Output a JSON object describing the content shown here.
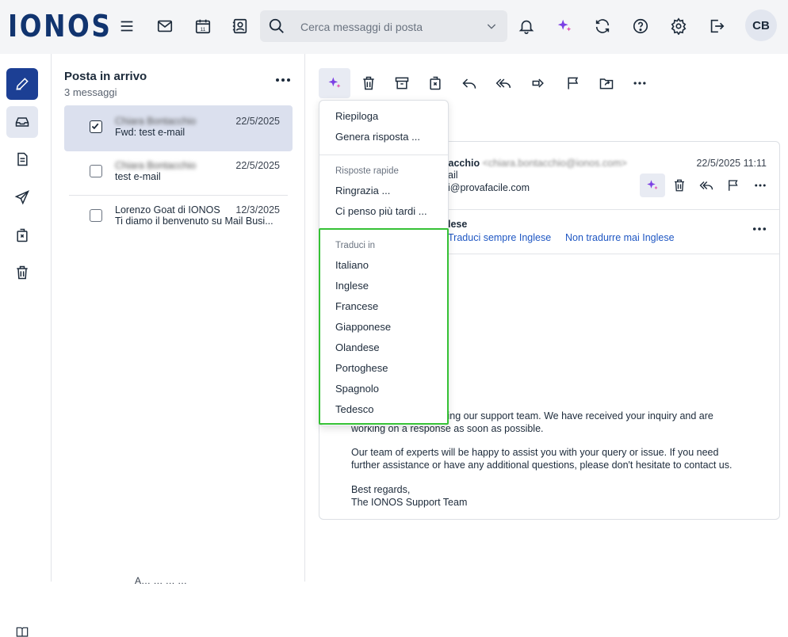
{
  "header": {
    "logo": "IONOS",
    "search_placeholder": "Cerca messaggi di posta",
    "avatar_initials": "CB",
    "calendar_day": "11"
  },
  "folder": {
    "title": "Posta in arrivo",
    "count": "3 messaggi"
  },
  "messages": [
    {
      "sender": "Chiara Bontacchio",
      "subject": "Fwd: test e-mail",
      "date": "22/5/2025",
      "checked": true
    },
    {
      "sender": "Chiara Bontacchio",
      "subject": "test e-mail",
      "date": "22/5/2025",
      "checked": false
    },
    {
      "sender": "Lorenzo Goat di IONOS",
      "subject": "Ti diamo il benvenuto su Mail Busi...",
      "date": "12/3/2025",
      "checked": false
    }
  ],
  "email": {
    "from_name": "…acchio",
    "from_addr": "<chiara.bontacchio@ionos.com>",
    "to_line": "ail",
    "cc_line": "i@provafacile.com",
    "date": "22/5/2025 11:11",
    "detected_lang": "lese",
    "translate_always": "Traduci sempre Inglese",
    "translate_never": "Non tradurre mai Inglese",
    "body_p1_line1": "ting our support team. We have received your inquiry and are",
    "body_p1_line2": "working on a response as soon as possible.",
    "body_p2_line1": "Our team of experts will be happy to assist you with your query or issue. If you need",
    "body_p2_line2": "further assistance or have any additional questions, please don't hesitate to contact us.",
    "body_p3_line1": "Best regards,",
    "body_p3_line2": "The IONOS Support Team"
  },
  "menu": {
    "items_top": [
      "Riepiloga",
      "Genera risposta ..."
    ],
    "quick_header": "Risposte rapide",
    "quick_items": [
      "Ringrazia ...",
      "Ci penso più tardi ..."
    ],
    "translate_header": "Traduci in",
    "languages": [
      "Italiano",
      "Inglese",
      "Francese",
      "Giapponese",
      "Olandese",
      "Portoghese",
      "Spagnolo",
      "Tedesco"
    ]
  },
  "footer": {
    "partial_text": "A…   …  …  …"
  },
  "colors": {
    "brand": "#11346f",
    "compose": "#1c3f94",
    "ai_accent": "#7b3fe4",
    "highlight": "#35c135",
    "link": "#1f57c3"
  }
}
